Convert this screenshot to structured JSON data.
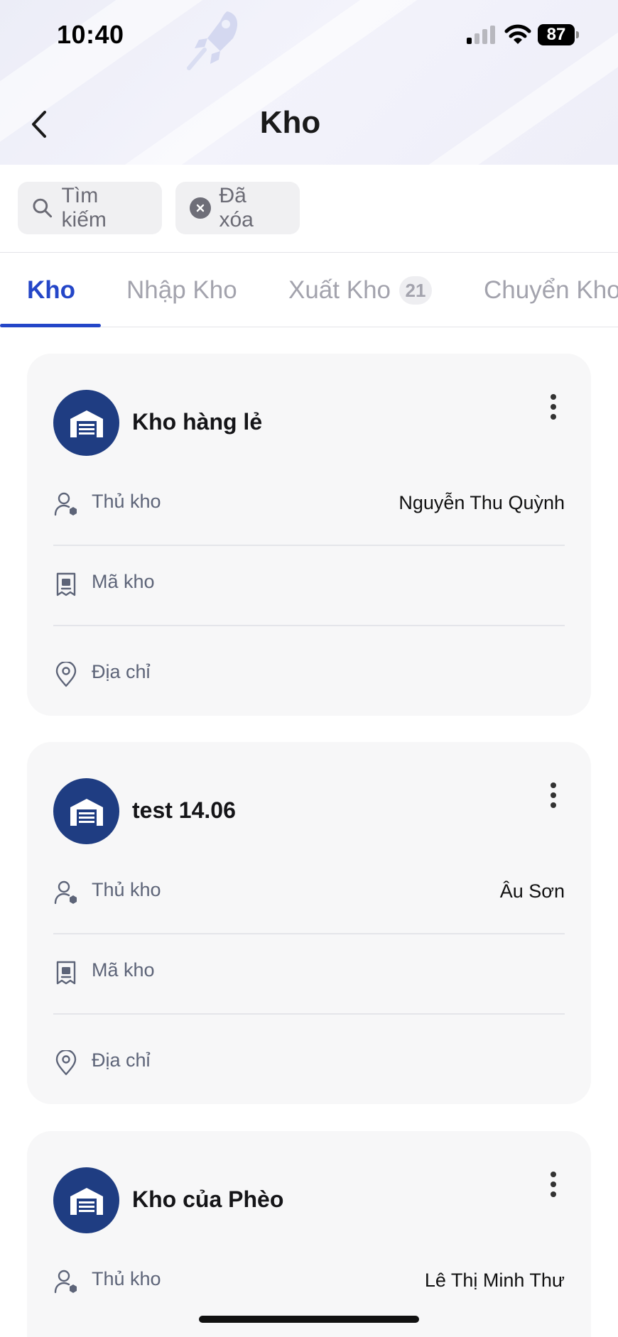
{
  "status_bar": {
    "time": "10:40",
    "battery": "87"
  },
  "header": {
    "title": "Kho"
  },
  "filters": {
    "search_label": "Tìm kiếm",
    "deleted_label": "Đã xóa"
  },
  "tabs": [
    {
      "label": "Kho",
      "active": true
    },
    {
      "label": "Nhập Kho",
      "active": false
    },
    {
      "label": "Xuất Kho",
      "badge": "21",
      "active": false
    },
    {
      "label": "Chuyển Kho",
      "active": false
    }
  ],
  "field_labels": {
    "keeper": "Thủ kho",
    "code": "Mã kho",
    "address": "Địa chỉ"
  },
  "warehouses": [
    {
      "name": "Kho hàng lẻ",
      "keeper": "Nguyễn Thu Quỳnh",
      "code": "",
      "address": ""
    },
    {
      "name": "test 14.06",
      "keeper": "Âu Sơn",
      "code": "",
      "address": ""
    },
    {
      "name": "Kho của Phèo",
      "keeper": "Lê Thị Minh Thư"
    }
  ],
  "colors": {
    "accent": "#2446c8",
    "avatar": "#1f3d82",
    "card_bg": "#f7f7f8"
  },
  "icons": [
    "back-icon",
    "search-icon",
    "close-icon",
    "warehouse-icon",
    "more-icon",
    "user-icon",
    "code-icon",
    "location-icon"
  ]
}
